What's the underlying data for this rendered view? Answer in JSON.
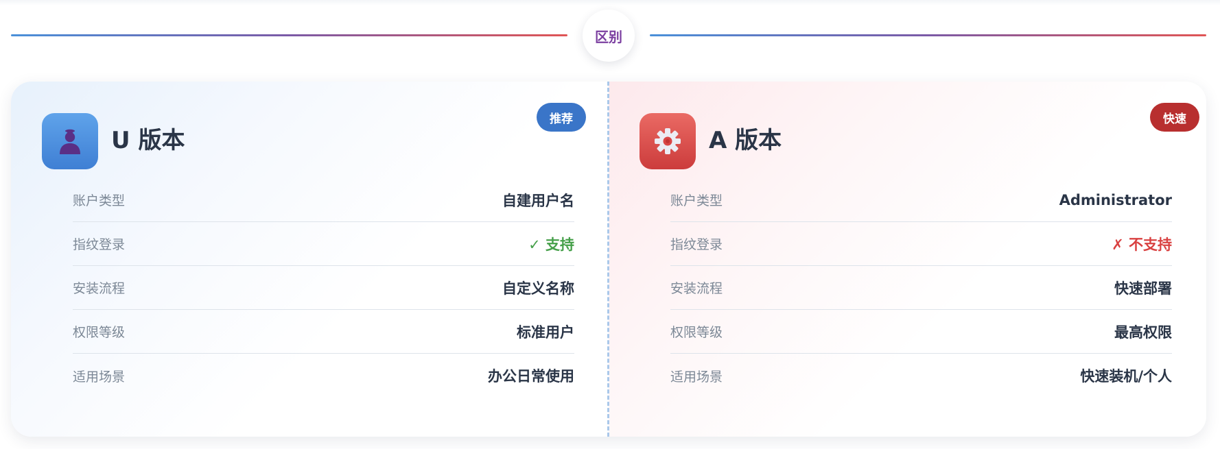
{
  "divider": {
    "label": "区别"
  },
  "cards": [
    {
      "title": "U 版本",
      "tag": "推荐",
      "icon": "user-icon",
      "accent": "#3a75c8",
      "rows": [
        {
          "label": "账户类型",
          "value": "自建用户名"
        },
        {
          "label": "指纹登录",
          "value": "✓ 支持"
        },
        {
          "label": "安装流程",
          "value": "自定义名称"
        },
        {
          "label": "权限等级",
          "value": "标准用户"
        },
        {
          "label": "适用场景",
          "value": "办公日常使用"
        }
      ]
    },
    {
      "title": "A 版本",
      "tag": "快速",
      "icon": "gear-icon",
      "accent": "#b82f2f",
      "rows": [
        {
          "label": "账户类型",
          "value": "Administrator"
        },
        {
          "label": "指纹登录",
          "value": "✗ 不支持"
        },
        {
          "label": "安装流程",
          "value": "快速部署"
        },
        {
          "label": "权限等级",
          "value": "最高权限"
        },
        {
          "label": "适用场景",
          "value": "快速装机/个人"
        }
      ]
    }
  ]
}
